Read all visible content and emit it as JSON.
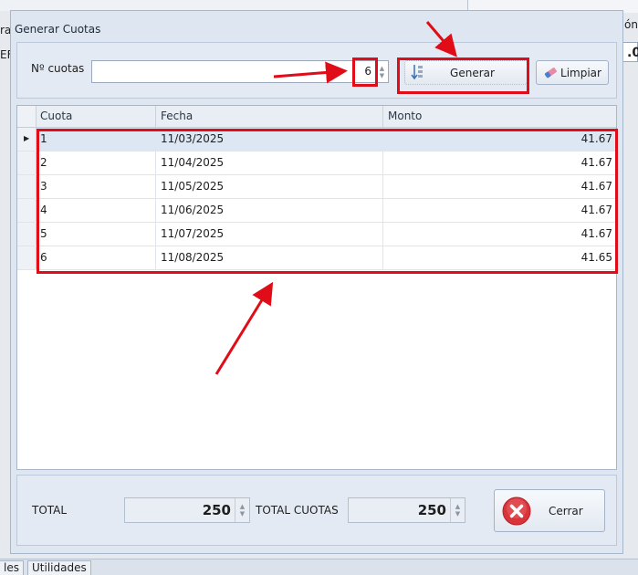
{
  "background": {
    "left_label": "ra",
    "left_field": "EF",
    "right_label": "ón",
    "right_field": ".0",
    "bottom_tabs": [
      "les",
      "Utilidades"
    ]
  },
  "dialog": {
    "title": "Generar Cuotas",
    "cuotas_label": "Nº cuotas",
    "cuotas_value": "6",
    "generar_label": "Generar",
    "limpiar_label": "Limpiar"
  },
  "grid": {
    "columns": [
      "Cuota",
      "Fecha",
      "Monto"
    ],
    "rows": [
      {
        "cuota": "1",
        "fecha": "11/03/2025",
        "monto": "41.67"
      },
      {
        "cuota": "2",
        "fecha": "11/04/2025",
        "monto": "41.67"
      },
      {
        "cuota": "3",
        "fecha": "11/05/2025",
        "monto": "41.67"
      },
      {
        "cuota": "4",
        "fecha": "11/06/2025",
        "monto": "41.67"
      },
      {
        "cuota": "5",
        "fecha": "11/07/2025",
        "monto": "41.67"
      },
      {
        "cuota": "6",
        "fecha": "11/08/2025",
        "monto": "41.65"
      }
    ]
  },
  "footer": {
    "total_label": "TOTAL",
    "total_value": "250",
    "total_cuotas_label": "TOTAL CUOTAS",
    "total_cuotas_value": "250",
    "cerrar_label": "Cerrar"
  },
  "colors": {
    "annotation_red": "#e00d18",
    "dialog_bg": "#dde6f1",
    "close_icon_red": "#d9343a"
  },
  "icons": {
    "generar": "generate-icon",
    "limpiar": "eraser-icon",
    "cerrar": "close-circle-icon"
  }
}
